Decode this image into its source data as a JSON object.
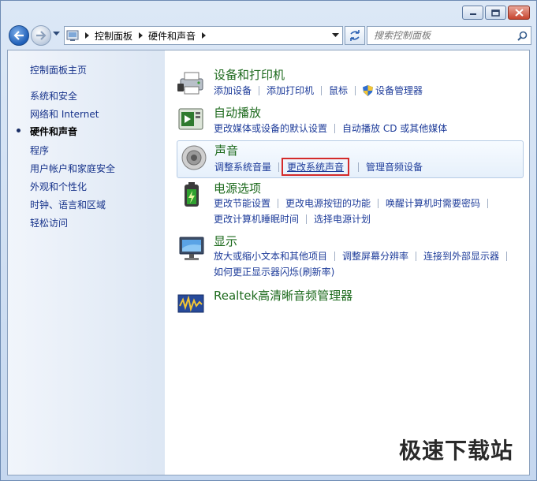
{
  "window": {
    "minimize": "minimize",
    "maximize": "maximize",
    "close": "close"
  },
  "address": {
    "crumbs": [
      "控制面板",
      "硬件和声音"
    ]
  },
  "search": {
    "placeholder": "搜索控制面板"
  },
  "sidebar": {
    "home": "控制面板主页",
    "items": [
      {
        "label": "系统和安全",
        "active": false
      },
      {
        "label": "网络和 Internet",
        "active": false
      },
      {
        "label": "硬件和声音",
        "active": true
      },
      {
        "label": "程序",
        "active": false
      },
      {
        "label": "用户帐户和家庭安全",
        "active": false
      },
      {
        "label": "外观和个性化",
        "active": false
      },
      {
        "label": "时钟、语言和区域",
        "active": false
      },
      {
        "label": "轻松访问",
        "active": false
      }
    ]
  },
  "categories": {
    "devices": {
      "title": "设备和打印机",
      "links": [
        "添加设备",
        "添加打印机",
        "鼠标",
        "设备管理器"
      ]
    },
    "autoplay": {
      "title": "自动播放",
      "links": [
        "更改媒体或设备的默认设置",
        "自动播放 CD 或其他媒体"
      ]
    },
    "sound": {
      "title": "声音",
      "links": [
        "调整系统音量",
        "更改系统声音",
        "管理音频设备"
      ]
    },
    "power": {
      "title": "电源选项",
      "links": [
        "更改节能设置",
        "更改电源按钮的功能",
        "唤醒计算机时需要密码",
        "更改计算机睡眠时间",
        "选择电源计划"
      ]
    },
    "display": {
      "title": "显示",
      "links": [
        "放大或缩小文本和其他项目",
        "调整屏幕分辨率",
        "连接到外部显示器",
        "如何更正显示器闪烁(刷新率)"
      ]
    },
    "realtek": {
      "title": "Realtek高清晰音频管理器"
    }
  },
  "watermark": "极速下载站",
  "colors": {
    "link": "#1e3c9a",
    "category_title": "#1d6a1d",
    "highlight_box": "#d42b2b",
    "sidebar_bg": "#e6eef8"
  }
}
